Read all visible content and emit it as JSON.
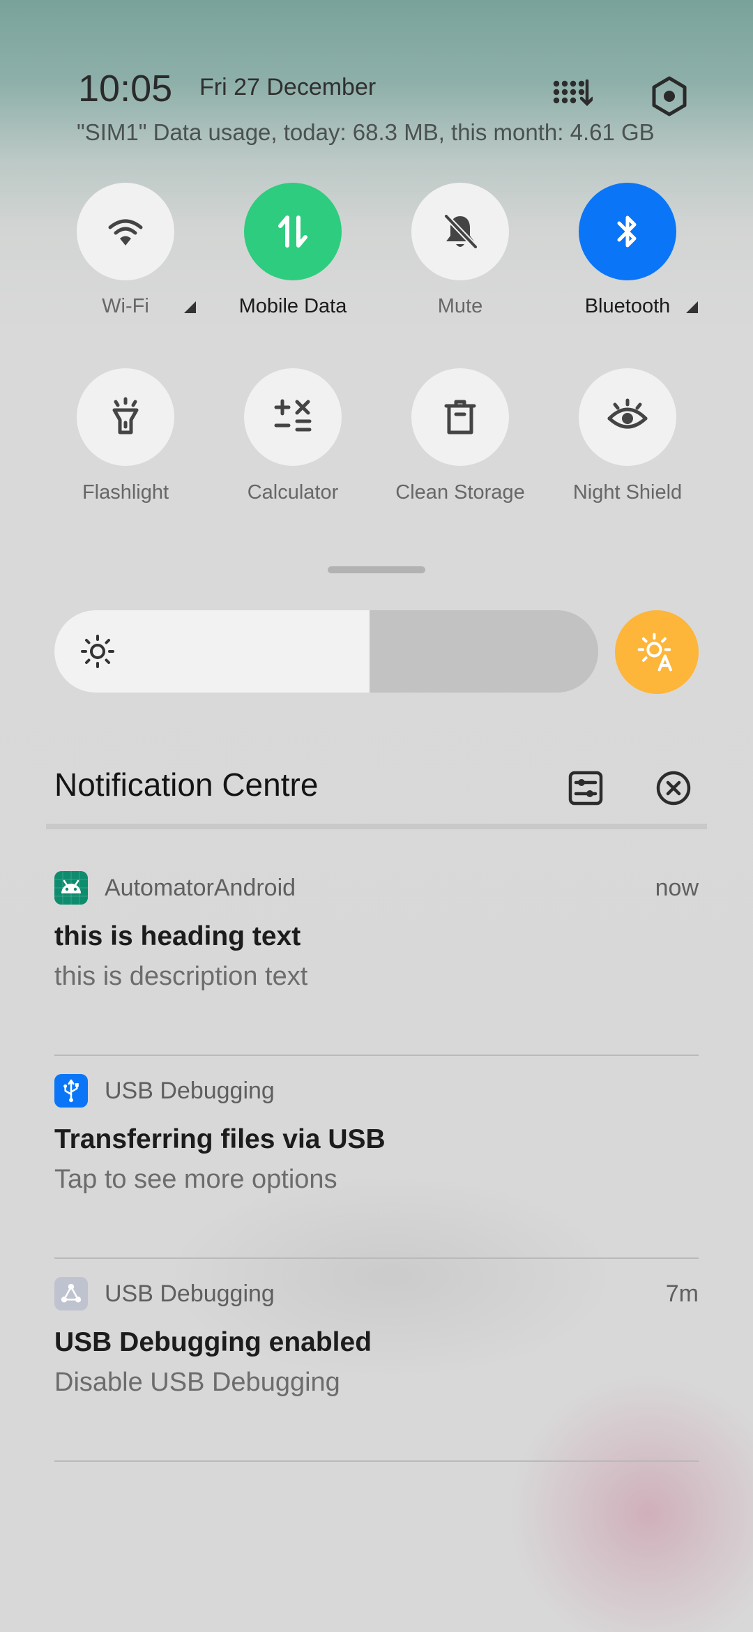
{
  "header": {
    "time": "10:05",
    "date": "Fri 27 December",
    "data_usage": "\"SIM1\" Data usage, today: 68.3 MB, this month: 4.61 GB",
    "edit_icon": "grid-edit-icon",
    "settings_icon": "settings-icon"
  },
  "quick_settings": [
    {
      "label": "Wi-Fi",
      "icon": "wifi-icon",
      "active": false,
      "expandable": true
    },
    {
      "label": "Mobile Data",
      "icon": "mobile-data-icon",
      "active": true,
      "active_color": "#2ecc7e",
      "expandable": false
    },
    {
      "label": "Mute",
      "icon": "bell-off-icon",
      "active": false,
      "expandable": false
    },
    {
      "label": "Bluetooth",
      "icon": "bluetooth-icon",
      "active": true,
      "active_color": "#0a76f7",
      "expandable": true
    },
    {
      "label": "Flashlight",
      "icon": "flashlight-icon",
      "active": false,
      "expandable": false
    },
    {
      "label": "Calculator",
      "icon": "calculator-icon",
      "active": false,
      "expandable": false
    },
    {
      "label": "Clean Storage",
      "icon": "trash-icon",
      "active": false,
      "expandable": false
    },
    {
      "label": "Night Shield",
      "icon": "eye-icon",
      "active": false,
      "expandable": false
    }
  ],
  "brightness": {
    "level": 0.58,
    "icon": "sun-icon",
    "auto_icon": "auto-brightness-icon",
    "auto_color": "#fdb53a"
  },
  "notification_centre": {
    "title": "Notification Centre",
    "manage_icon": "notification-settings-icon",
    "clear_icon": "clear-all-icon"
  },
  "notifications": [
    {
      "app": "AutomatorAndroid",
      "time": "now",
      "title": "this is heading text",
      "desc": "this is description text",
      "icon": "android-icon"
    },
    {
      "app": "USB Debugging",
      "time": "",
      "title": "Transferring files via USB",
      "desc": "Tap to see more options",
      "icon": "usb-icon"
    },
    {
      "app": "USB Debugging",
      "time": "7m",
      "title": "USB Debugging enabled",
      "desc": "Disable USB Debugging",
      "icon": "debug-icon"
    }
  ]
}
